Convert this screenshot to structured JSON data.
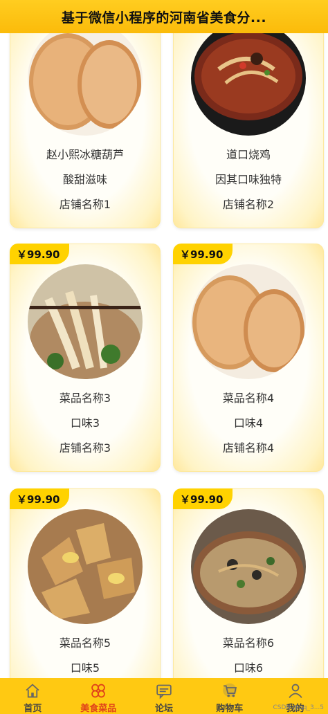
{
  "header": {
    "title": "基于微信小程序的河南省美食分..."
  },
  "cards": [
    {
      "price": "",
      "name": "赵小熙冰糖葫芦",
      "taste": "酸甜滋味",
      "shop": "店铺名称1"
    },
    {
      "price": "",
      "name": "道口烧鸡",
      "taste": "因其口味独特",
      "shop": "店铺名称2"
    },
    {
      "price": "￥99.90",
      "name": "菜品名称3",
      "taste": "口味3",
      "shop": "店铺名称3"
    },
    {
      "price": "￥99.90",
      "name": "菜品名称4",
      "taste": "口味4",
      "shop": "店铺名称4"
    },
    {
      "price": "￥99.90",
      "name": "菜品名称5",
      "taste": "口味5",
      "shop": ""
    },
    {
      "price": "￥99.90",
      "name": "菜品名称6",
      "taste": "口味6",
      "shop": ""
    }
  ],
  "tabs": [
    {
      "label": "首页",
      "icon": "home-icon"
    },
    {
      "label": "美食菜品",
      "icon": "food-grid-icon"
    },
    {
      "label": "论坛",
      "icon": "forum-icon"
    },
    {
      "label": "购物车",
      "icon": "cart-icon"
    },
    {
      "label": "我的",
      "icon": "user-icon"
    }
  ],
  "active_tab_index": 1,
  "watermark": "CSDN @qq_3...5",
  "colors": {
    "header": "#ffc912",
    "price_tag": "#ffd200",
    "active_tab": "#e0421a"
  }
}
